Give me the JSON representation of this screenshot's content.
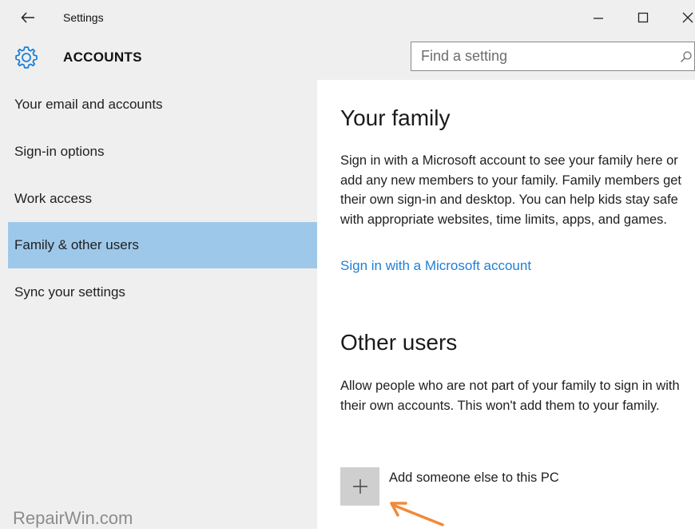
{
  "window": {
    "title": "Settings"
  },
  "header": {
    "section_title": "ACCOUNTS",
    "search_placeholder": "Find a setting"
  },
  "sidebar": {
    "items": [
      {
        "label": "Your email and accounts"
      },
      {
        "label": "Sign-in options"
      },
      {
        "label": "Work access"
      },
      {
        "label": "Family & other users",
        "selected": true
      },
      {
        "label": "Sync your settings"
      }
    ]
  },
  "content": {
    "family": {
      "heading": "Your family",
      "description": "Sign in with a Microsoft account to see your family here or add any new members to your family. Family members get their own sign-in and desktop. You can help kids stay safe with appropriate websites, time limits, apps, and games.",
      "link": "Sign in with a Microsoft account"
    },
    "other_users": {
      "heading": "Other users",
      "description": "Allow people who are not part of your family to sign in with their own accounts. This won't add them to your family.",
      "add_label": "Add someone else to this PC"
    }
  },
  "watermark": "RepairWin.com",
  "colors": {
    "accent": "#1e7fd6",
    "selected_bg": "#9ec8ea",
    "chrome_bg": "#efefef",
    "arrow": "#f08a3a"
  },
  "icons": {
    "back": "back-arrow-icon",
    "minimize": "minimize-icon",
    "maximize": "maximize-icon",
    "close": "close-icon",
    "gear": "gear-icon",
    "search": "search-icon",
    "add": "plus-icon",
    "annotation": "orange-arrow-icon"
  }
}
